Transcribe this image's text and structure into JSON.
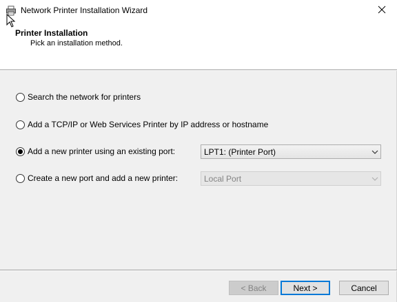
{
  "window": {
    "title": "Network Printer Installation Wizard",
    "icon": "printer-icon"
  },
  "header": {
    "title": "Printer Installation",
    "subtitle": "Pick an installation method."
  },
  "options": [
    {
      "label": "Search the network for printers",
      "checked": false
    },
    {
      "label": "Add a TCP/IP or Web Services Printer by IP address or hostname",
      "checked": false
    },
    {
      "label": "Add a new printer using an existing port:",
      "checked": true
    },
    {
      "label": "Create a new port and add a new printer:",
      "checked": false
    }
  ],
  "existing_port_select": {
    "value": "LPT1: (Printer Port)",
    "enabled": true
  },
  "new_port_select": {
    "value": "Local Port",
    "enabled": false
  },
  "buttons": {
    "back": "< Back",
    "next": "Next >",
    "cancel": "Cancel"
  },
  "colors": {
    "accent": "#0078d7",
    "dialog_bg": "#f0f0f0",
    "header_bg": "#ffffff"
  }
}
